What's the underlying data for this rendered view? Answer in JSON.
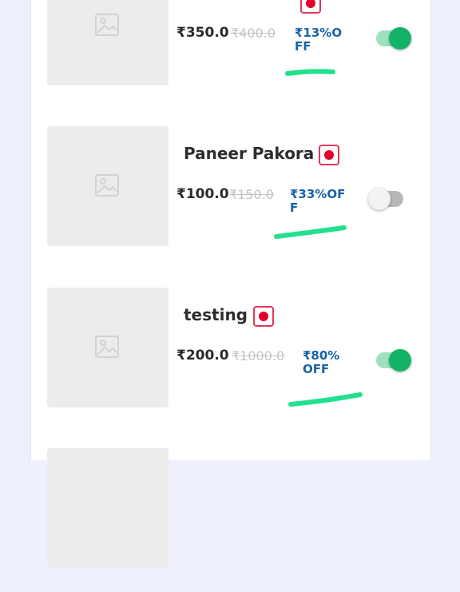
{
  "items": [
    {
      "name": "",
      "price": "₹350.0",
      "original_price": "₹400.0",
      "discount": "₹13%OFF",
      "available": true
    },
    {
      "name": "Paneer Pakora",
      "price": "₹100.0",
      "original_price": "₹150.0",
      "discount": "₹33%OFF",
      "available": false
    },
    {
      "name": "testing",
      "price": "₹200.0",
      "original_price": "₹1000.0",
      "discount": "₹80%OFF",
      "available": true
    }
  ],
  "colors": {
    "accent_green": "#12b366",
    "discount_blue": "#1763a6",
    "veg_red": "#e3002b",
    "highlight_marker": "#22e08e"
  }
}
